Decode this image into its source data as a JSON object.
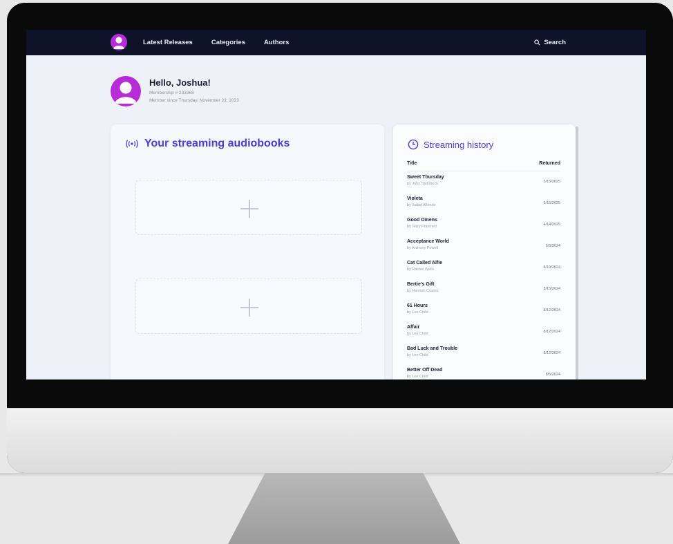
{
  "nav": {
    "links": [
      "Latest Releases",
      "Categories",
      "Authors"
    ],
    "search_label": "Search"
  },
  "profile": {
    "greeting": "Hello, Joshua!",
    "membership": "Membership # 233368",
    "member_since": "Member since Thursday, November 23, 2023"
  },
  "streaming": {
    "title": "Your streaming audiobooks",
    "slots": 2
  },
  "history": {
    "title": "Streaming history",
    "col_title": "Title",
    "col_returned": "Returned",
    "rows": [
      {
        "title": "Sweet Thursday",
        "author": "by John Steinbeck",
        "returned": "5/15/2025"
      },
      {
        "title": "Violeta",
        "author": "by Isabel Allende",
        "returned": "5/15/2025"
      },
      {
        "title": "Good Omens",
        "author": "by Terry Pratchett",
        "returned": "4/14/2025"
      },
      {
        "title": "Acceptance World",
        "author": "by Anthony Powell",
        "returned": "9/3/2024"
      },
      {
        "title": "Cat Called Alfie",
        "author": "by Rachel Wells",
        "returned": "8/19/2024"
      },
      {
        "title": "Bertie's Gift",
        "author": "by Hannah Coates",
        "returned": "8/15/2024"
      },
      {
        "title": "61 Hours",
        "author": "by Lee Child",
        "returned": "8/12/2024"
      },
      {
        "title": "Affair",
        "author": "by Lee Child",
        "returned": "8/12/2024"
      },
      {
        "title": "Bad Luck and Trouble",
        "author": "by Lee Child",
        "returned": "8/12/2024"
      },
      {
        "title": "Better Off Dead",
        "author": "by Lee Child",
        "returned": "8/5/2024"
      }
    ]
  },
  "colors": {
    "nav_bg": "#0f1329",
    "accent": "#4a3cd6",
    "avatar": "#b62dd8",
    "page_bg": "#eef2f8"
  }
}
